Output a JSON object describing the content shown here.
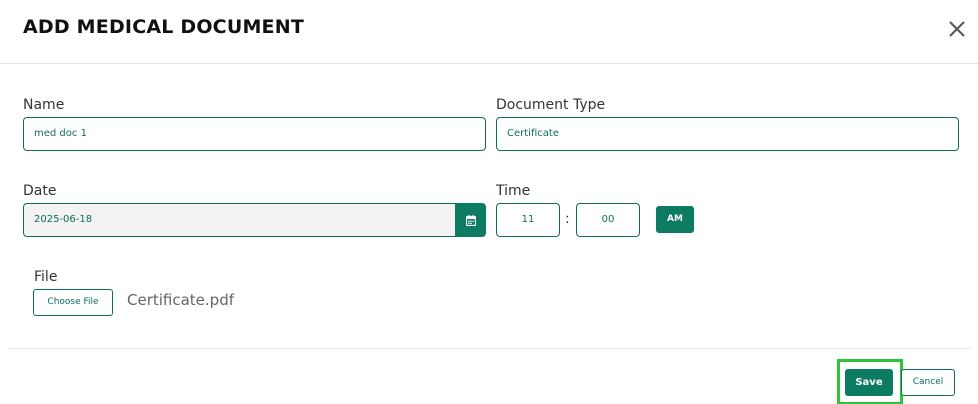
{
  "modal": {
    "title": "ADD MEDICAL DOCUMENT",
    "close_icon": "close-icon"
  },
  "form": {
    "name": {
      "label": "Name",
      "value": "med doc 1"
    },
    "document_type": {
      "label": "Document Type",
      "value": "Certificate"
    },
    "date": {
      "label": "Date",
      "value": "2025-06-18",
      "icon": "calendar-icon"
    },
    "time": {
      "label": "Time",
      "hour": "11",
      "separator": ":",
      "minute": "00",
      "period": "AM"
    },
    "file": {
      "label": "File",
      "button_label": "Choose File",
      "filename": "Certificate.pdf"
    }
  },
  "footer": {
    "save_label": "Save",
    "cancel_label": "Cancel"
  },
  "colors": {
    "accent": "#0d7a62",
    "highlight": "#2fc33a"
  }
}
